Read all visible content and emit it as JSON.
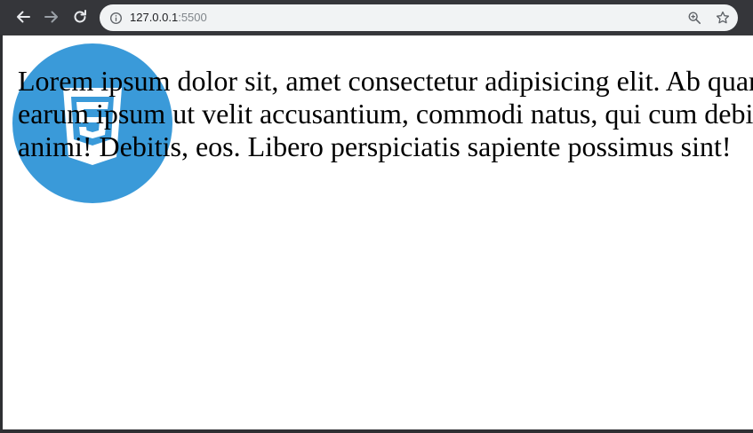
{
  "browser": {
    "url_host": "127.0.0.1",
    "url_port": ":5500",
    "icons": {
      "back": "arrow-left-icon",
      "forward": "arrow-right-icon",
      "reload": "reload-icon",
      "site_info": "info-icon",
      "zoom": "zoom-in-icon",
      "bookmark": "star-icon"
    }
  },
  "page": {
    "logo_icon": "css3-logo",
    "paragraph_lines": [
      "Lorem ipsum dolor sit, amet consectetur adipisicing elit. Ab quam",
      "earum ipsum ut velit accusantium, commodi natus, qui cum debitis",
      "animi! Debitis, eos. Libero perspiciatis sapiente possimus sint!"
    ]
  },
  "colors": {
    "toolbar": "#35363a",
    "omnibox": "#f1f3f4",
    "logo_circle": "#3a9ad9",
    "text": "#000000"
  }
}
